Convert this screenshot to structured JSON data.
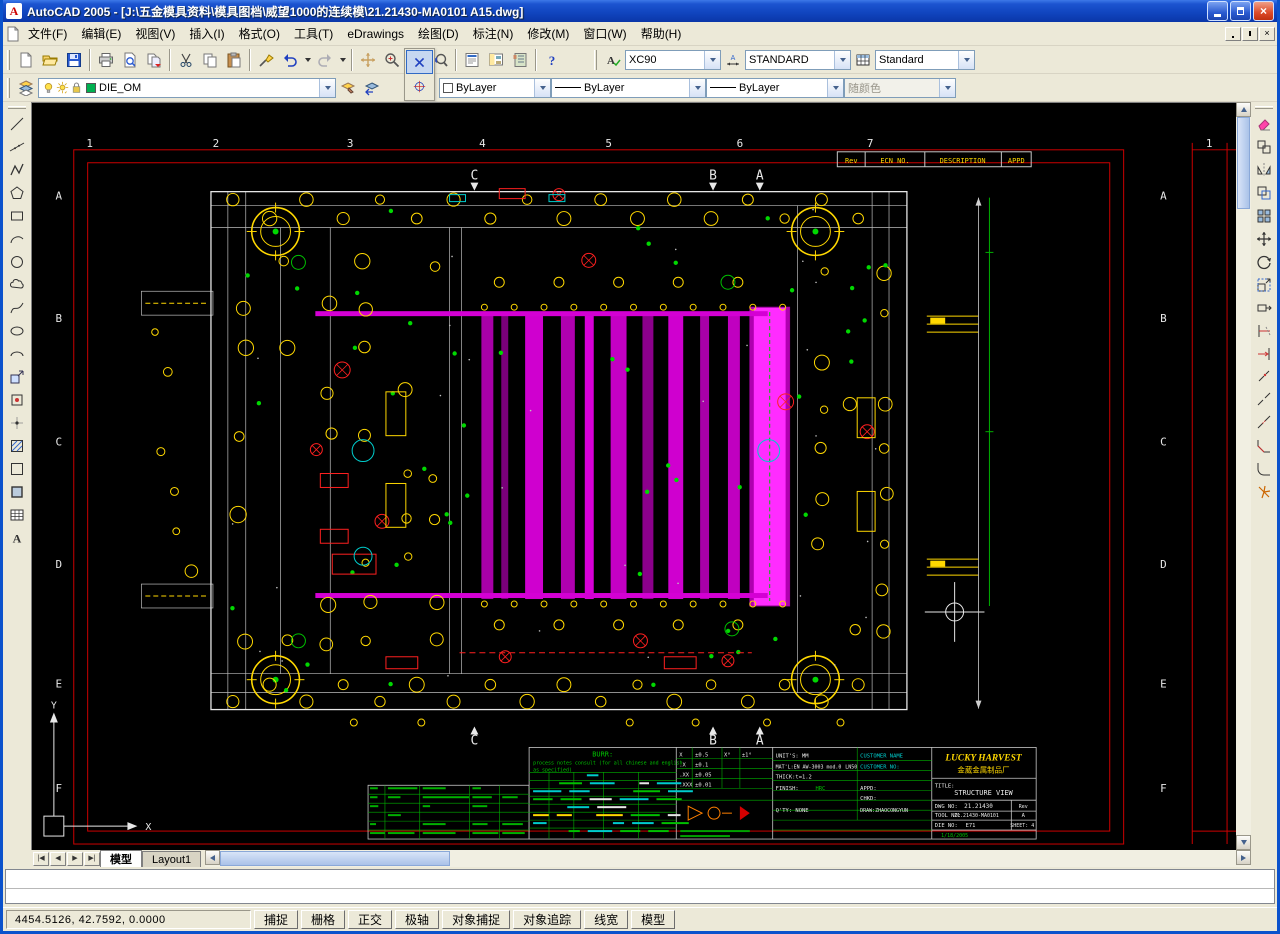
{
  "window": {
    "title": "AutoCAD 2005 - [J:\\五金模具资料\\模具图档\\威望1000的连续模\\21.21430-MA0101 A15.dwg]"
  },
  "icons": {
    "letter_a": "A",
    "question_mark": "?",
    "close_x": "×"
  },
  "menu": {
    "items": [
      "文件(F)",
      "编辑(E)",
      "视图(V)",
      "插入(I)",
      "格式(O)",
      "工具(T)",
      "eDrawings",
      "绘图(D)",
      "标注(N)",
      "修改(M)",
      "窗口(W)",
      "帮助(H)"
    ]
  },
  "toolbars": {
    "styles": {
      "text_style": "XC90",
      "dim_style": "STANDARD",
      "table_style": "Standard"
    },
    "layers": {
      "current_layer": "DIE_OM"
    },
    "properties": {
      "color": "ByLayer",
      "linetype": "ByLayer",
      "lineweight": "ByLayer",
      "plot_style": "随颜色"
    }
  },
  "tabs": {
    "nav": [
      "|◀",
      "◀",
      "▶",
      "▶|"
    ],
    "model": "模型",
    "layout1": "Layout1"
  },
  "status": {
    "coords": "4454.5126, 42.7592,  0.0000",
    "buttons": [
      "捕捉",
      "栅格",
      "正交",
      "极轴",
      "对象捕捉",
      "对象追踪",
      "线宽",
      "模型"
    ]
  },
  "drawing": {
    "zone_numbers": [
      "1",
      "2",
      "3",
      "4",
      "5",
      "6",
      "7"
    ],
    "zone_letters": [
      "A",
      "B",
      "C",
      "D",
      "E",
      "F"
    ],
    "sheet2_number": "1",
    "rev_table": {
      "rev": "Rev",
      "ecn": "ECN NO.",
      "desc": "DESCRIPTION",
      "appd": "APPD"
    },
    "sections": {
      "c": "C",
      "b": "B",
      "a": "A"
    },
    "axis": {
      "x": "X",
      "y": "Y"
    },
    "notes": {
      "line1": "process notes consult (for all chinese and english",
      "line2": "as specified)",
      "burr": "BURR:"
    },
    "tolerances": {
      "x": "X",
      "xv": "±0.5",
      "deg": "X°",
      "degv": "±1°",
      "x1": ".X",
      "x1v": "±0.1",
      "x2": ".XX",
      "x2v": "±0.05",
      "x3": ".XXX",
      "x3v": "±0.01"
    },
    "info": {
      "units": "UNIT'S: MM",
      "matl": "MAT'L:EN AW-3003 mod.0",
      "matl2": "LN50",
      "thick": "THICK:t=1.2",
      "finish": "FINISH:",
      "hrc": "HRC",
      "qty": "Q'TY:  NONE",
      "customer_name": "CUSTOMER NAME",
      "customer_no": "CUSTOMER NO:",
      "appd": "APPD:",
      "chkd": "CHKD:",
      "draw": "DRAW:ZHAOCONGYUN"
    },
    "title_block": {
      "company": "LUCKY  HARVEST",
      "company_cn": "金葳金属制品厂",
      "title_label": "TITLE:",
      "title": "STRUCTURE VIEW",
      "dwg_label": "DWG NO:",
      "dwg_no": "21.21430",
      "rev_label": "Rev",
      "tool_label": "TOOL NO:",
      "tool_no": "21.21430-MA0101",
      "rev_val": "A",
      "die_label": "DIE NO:",
      "die_no": "E71",
      "sheet": "SHEET: 4",
      "date": "1/18/2005"
    }
  }
}
